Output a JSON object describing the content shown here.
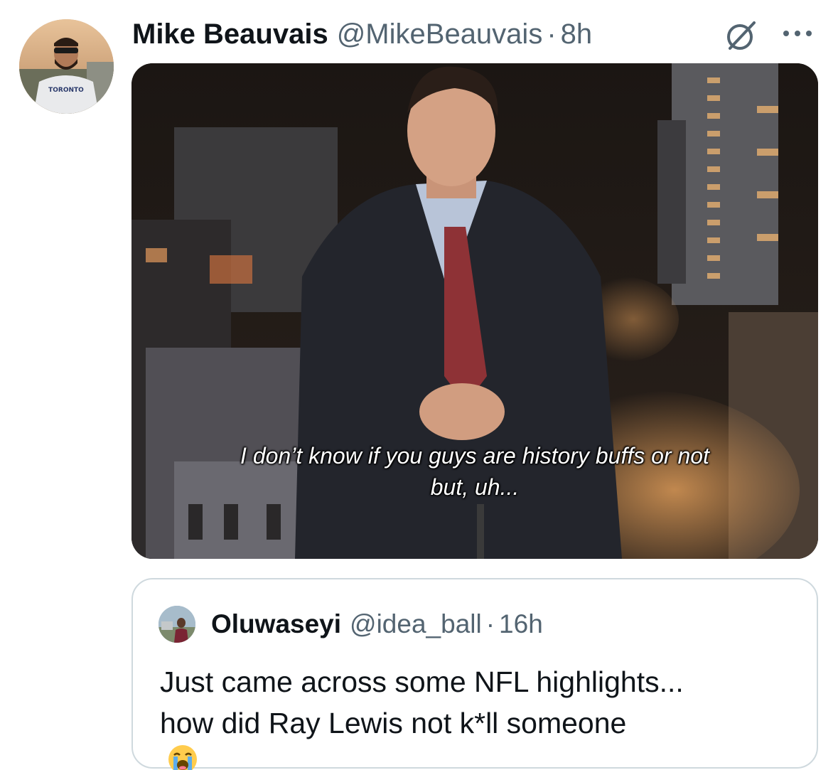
{
  "tweet": {
    "author": {
      "display_name": "Mike Beauvais",
      "handle": "@MikeBeauvais",
      "separator": "·",
      "time": "8h",
      "avatar_icon": "profile-photo"
    },
    "actions": {
      "noop_icon": "circle-slash-icon",
      "more_icon": "more-options-icon"
    },
    "media": {
      "caption_line1": "I don’t know if you guys are history buffs or not",
      "caption_line2": "but, uh..."
    }
  },
  "quoted_tweet": {
    "author": {
      "display_name": "Oluwaseyi",
      "handle": "@idea_ball",
      "separator": "·",
      "time": "16h"
    },
    "text_line1": "Just came across some NFL highlights...",
    "text_line2": "how did Ray Lewis not k*ll someone",
    "emoji": "loudly-crying-face"
  },
  "colors": {
    "text_primary": "#0f1419",
    "text_secondary": "#536471",
    "border": "#cfd9de",
    "background": "#ffffff"
  }
}
